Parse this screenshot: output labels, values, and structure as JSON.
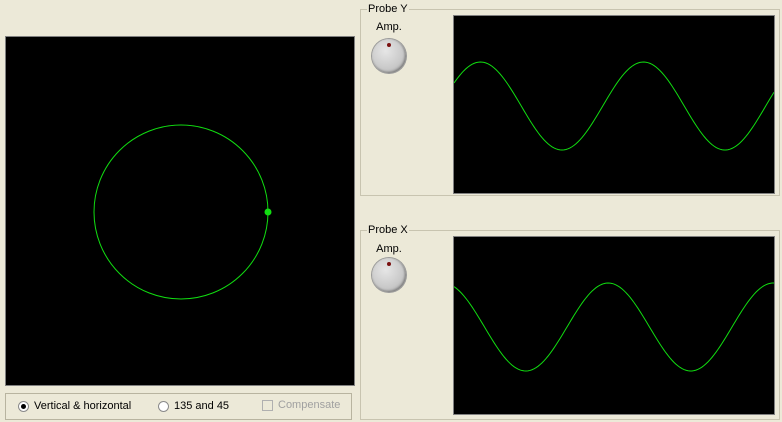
{
  "mode_panel": {
    "options": [
      {
        "label": "Vertical & horizontal",
        "checked": true
      },
      {
        "label": "135 and 45",
        "checked": false
      }
    ],
    "compensate": {
      "label": "Compensate",
      "checked": false,
      "enabled": false
    }
  },
  "probe_y": {
    "title": "Probe Y",
    "amp_label": "Amp."
  },
  "probe_x": {
    "title": "Probe X",
    "amp_label": "Amp."
  },
  "colors": {
    "trace": "#11dd11",
    "screen": "#000000",
    "knob_marker": "#7a1010"
  }
}
